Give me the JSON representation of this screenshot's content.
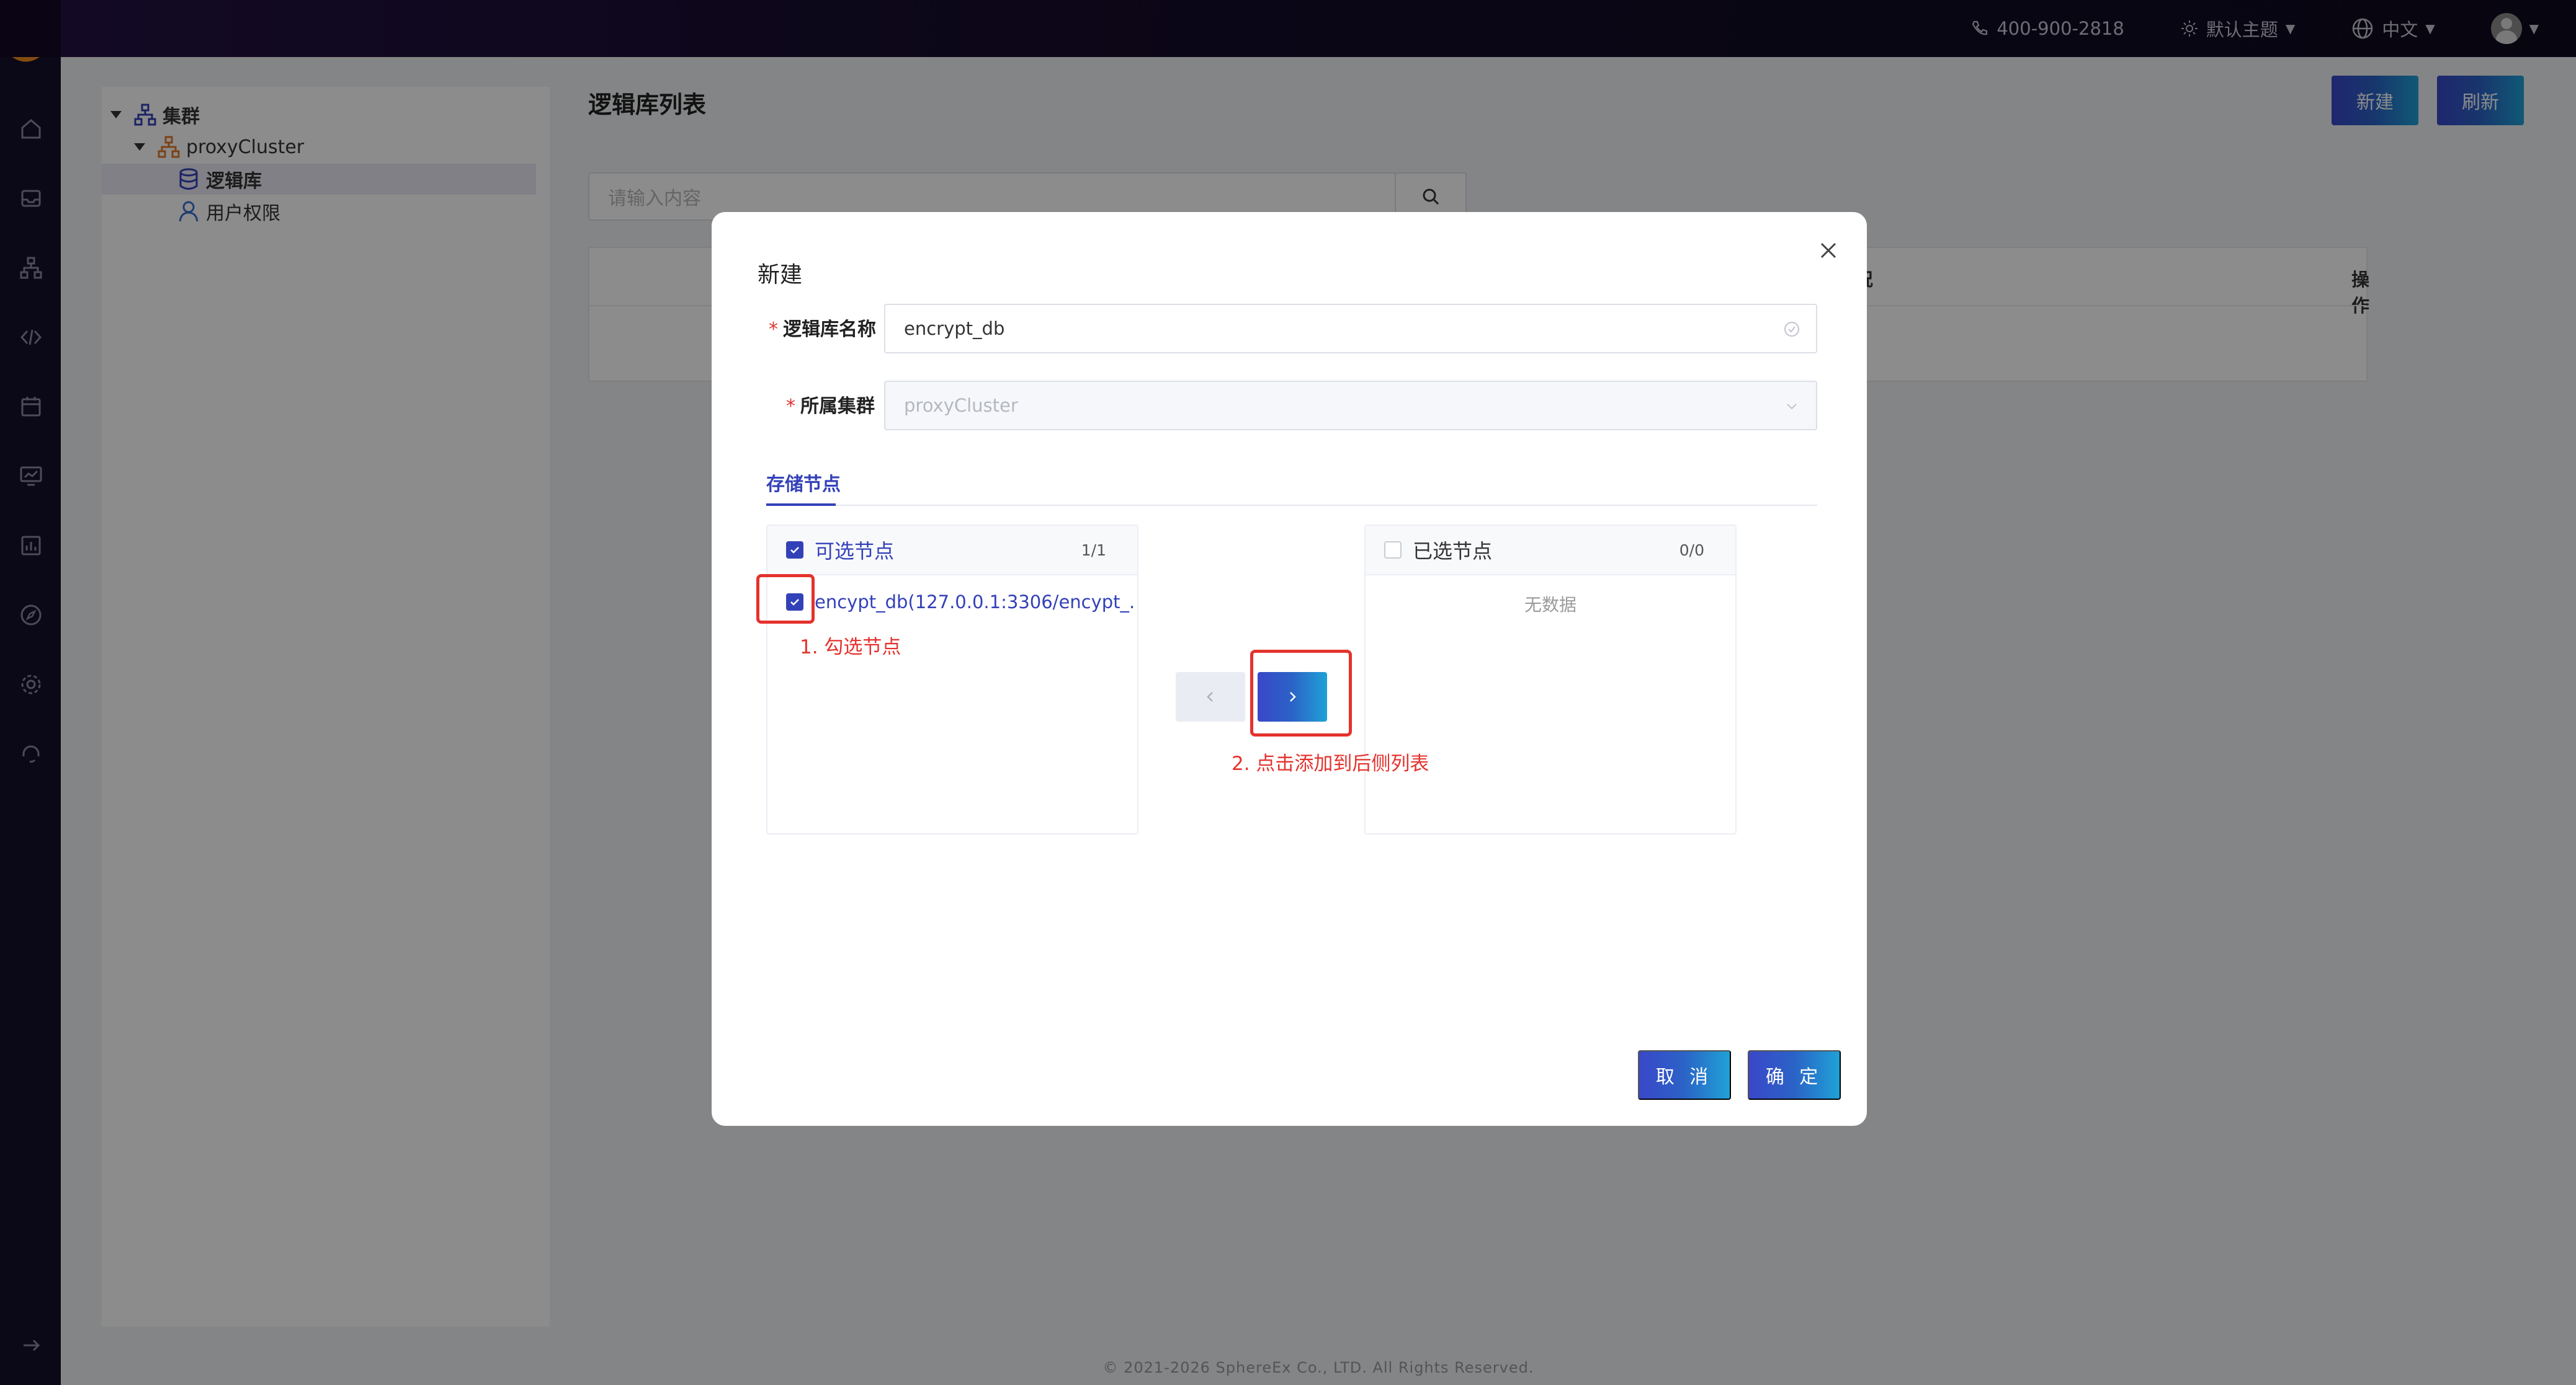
{
  "header": {
    "phone": "400-900-2818",
    "theme_label": "默认主题",
    "lang_label": "中文"
  },
  "tree": {
    "root": "集群",
    "cluster": "proxyCluster",
    "logic_db": "逻辑库",
    "user_perm": "用户权限"
  },
  "main": {
    "title": "逻辑库列表",
    "new_label": "新建",
    "refresh_label": "刷新",
    "search_placeholder": "请输入内容",
    "col_status_partial": "况",
    "col_actions": "操作"
  },
  "footer": {
    "copyright": "© 2021-2026 SphereEx Co., LTD. All Rights Reserved."
  },
  "modal": {
    "title": "新建",
    "logic_db_label": "逻辑库名称",
    "logic_db_value": "encrypt_db",
    "cluster_label": "所属集群",
    "cluster_value": "proxyCluster",
    "tab_storage": "存储节点",
    "left_title": "可选节点",
    "left_count": "1/1",
    "left_item": "encypt_db(127.0.0.1:3306/encypt_...",
    "right_title": "已选节点",
    "right_count": "0/0",
    "right_empty": "无数据",
    "cancel_label": "取 消",
    "confirm_label": "确 定",
    "annot_1": "1. 勾选节点",
    "annot_2": "2. 点击添加到后侧列表"
  }
}
